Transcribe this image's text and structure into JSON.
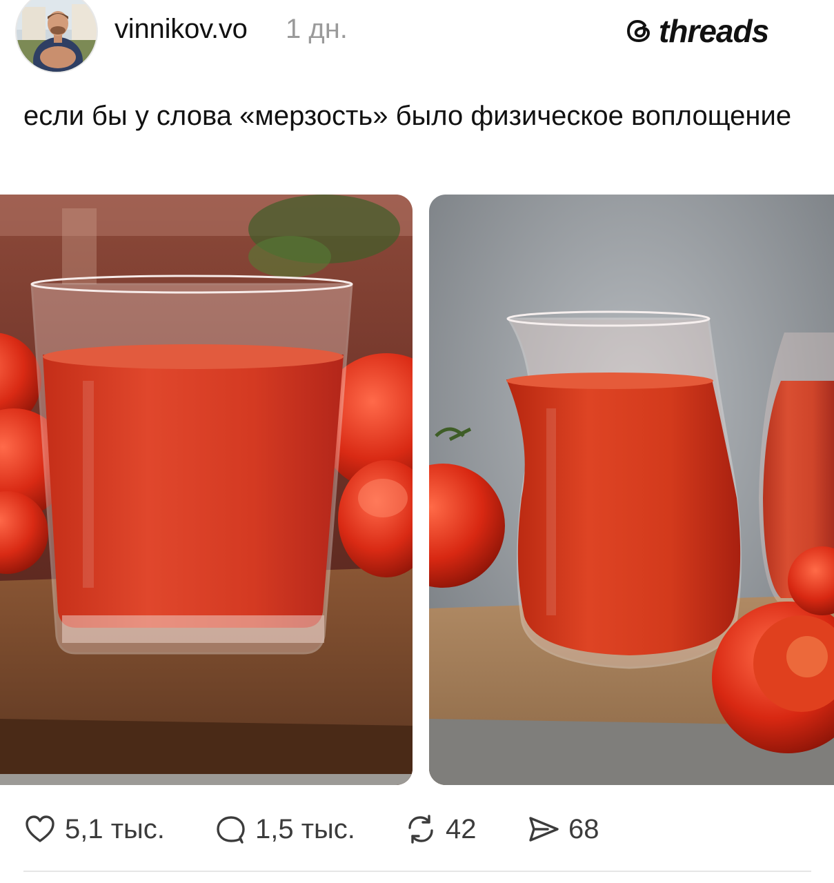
{
  "header": {
    "username": "vinnikov.vo",
    "timestamp": "1 дн.",
    "brand": "threads"
  },
  "post": {
    "text": "если бы у слова «мерзость» было физическое воплощение"
  },
  "images": [
    {
      "name": "tomato-juice-glass-1"
    },
    {
      "name": "tomato-juice-glass-2"
    }
  ],
  "actions": {
    "likes": "5,1 тыс.",
    "comments": "1,5 тыс.",
    "reposts": "42",
    "shares": "68"
  },
  "icons": {
    "like": "heart-icon",
    "comment": "speech-bubble-icon",
    "repost": "repost-arrows-icon",
    "share": "send-paper-plane-icon",
    "brand": "threads-logo-icon"
  },
  "colors": {
    "text": "#111111",
    "muted": "#9a9a9a",
    "action_text": "#3c3c3c",
    "juice": "#d9361f"
  }
}
